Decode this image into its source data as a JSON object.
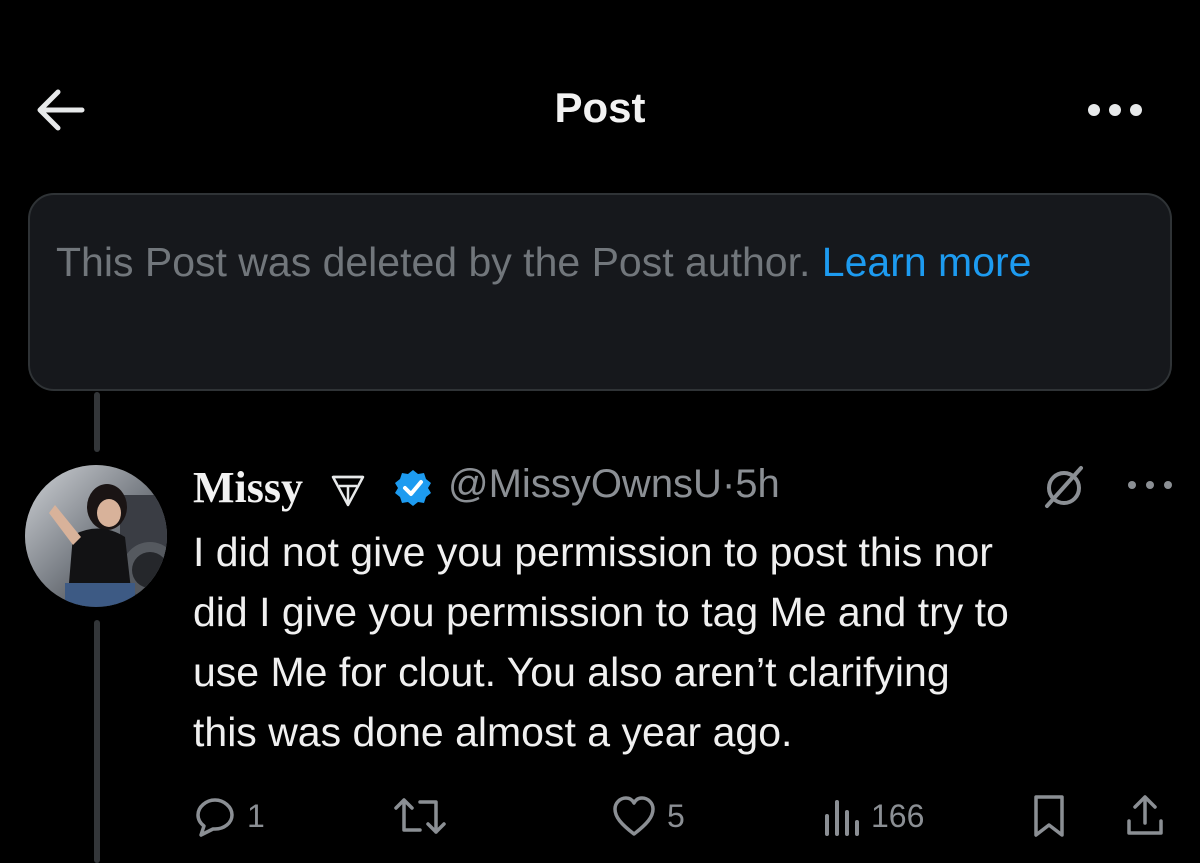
{
  "header": {
    "title": "Post"
  },
  "deleted_notice": {
    "text": "This Post was deleted by the Post author.",
    "link": "Learn more"
  },
  "post": {
    "author_name": "Missy",
    "handle": "@MissyOwnsU",
    "separator": "·",
    "time": "5h",
    "text": "I did not give you permission to post this nor\ndid I give you permission to tag Me and try to\nuse Me for clout. You also aren’t clarifying\nthis was done almost a year ago.",
    "counts": {
      "replies": "1",
      "reposts": "",
      "likes": "5",
      "views": "166"
    }
  },
  "icons": {
    "back": "arrow-left-icon",
    "more": "more-horizontal-icon",
    "name_symbol": "triangle-symbol-icon",
    "verified": "verified-badge-icon",
    "grok": "grok-icon",
    "reply": "reply-icon",
    "repost": "repost-icon",
    "like": "heart-icon",
    "views": "views-icon",
    "bookmark": "bookmark-icon",
    "share": "share-icon"
  },
  "colors": {
    "background": "#000000",
    "accent": "#1d9bf0",
    "muted": "#71767b",
    "card": "#16181c"
  }
}
